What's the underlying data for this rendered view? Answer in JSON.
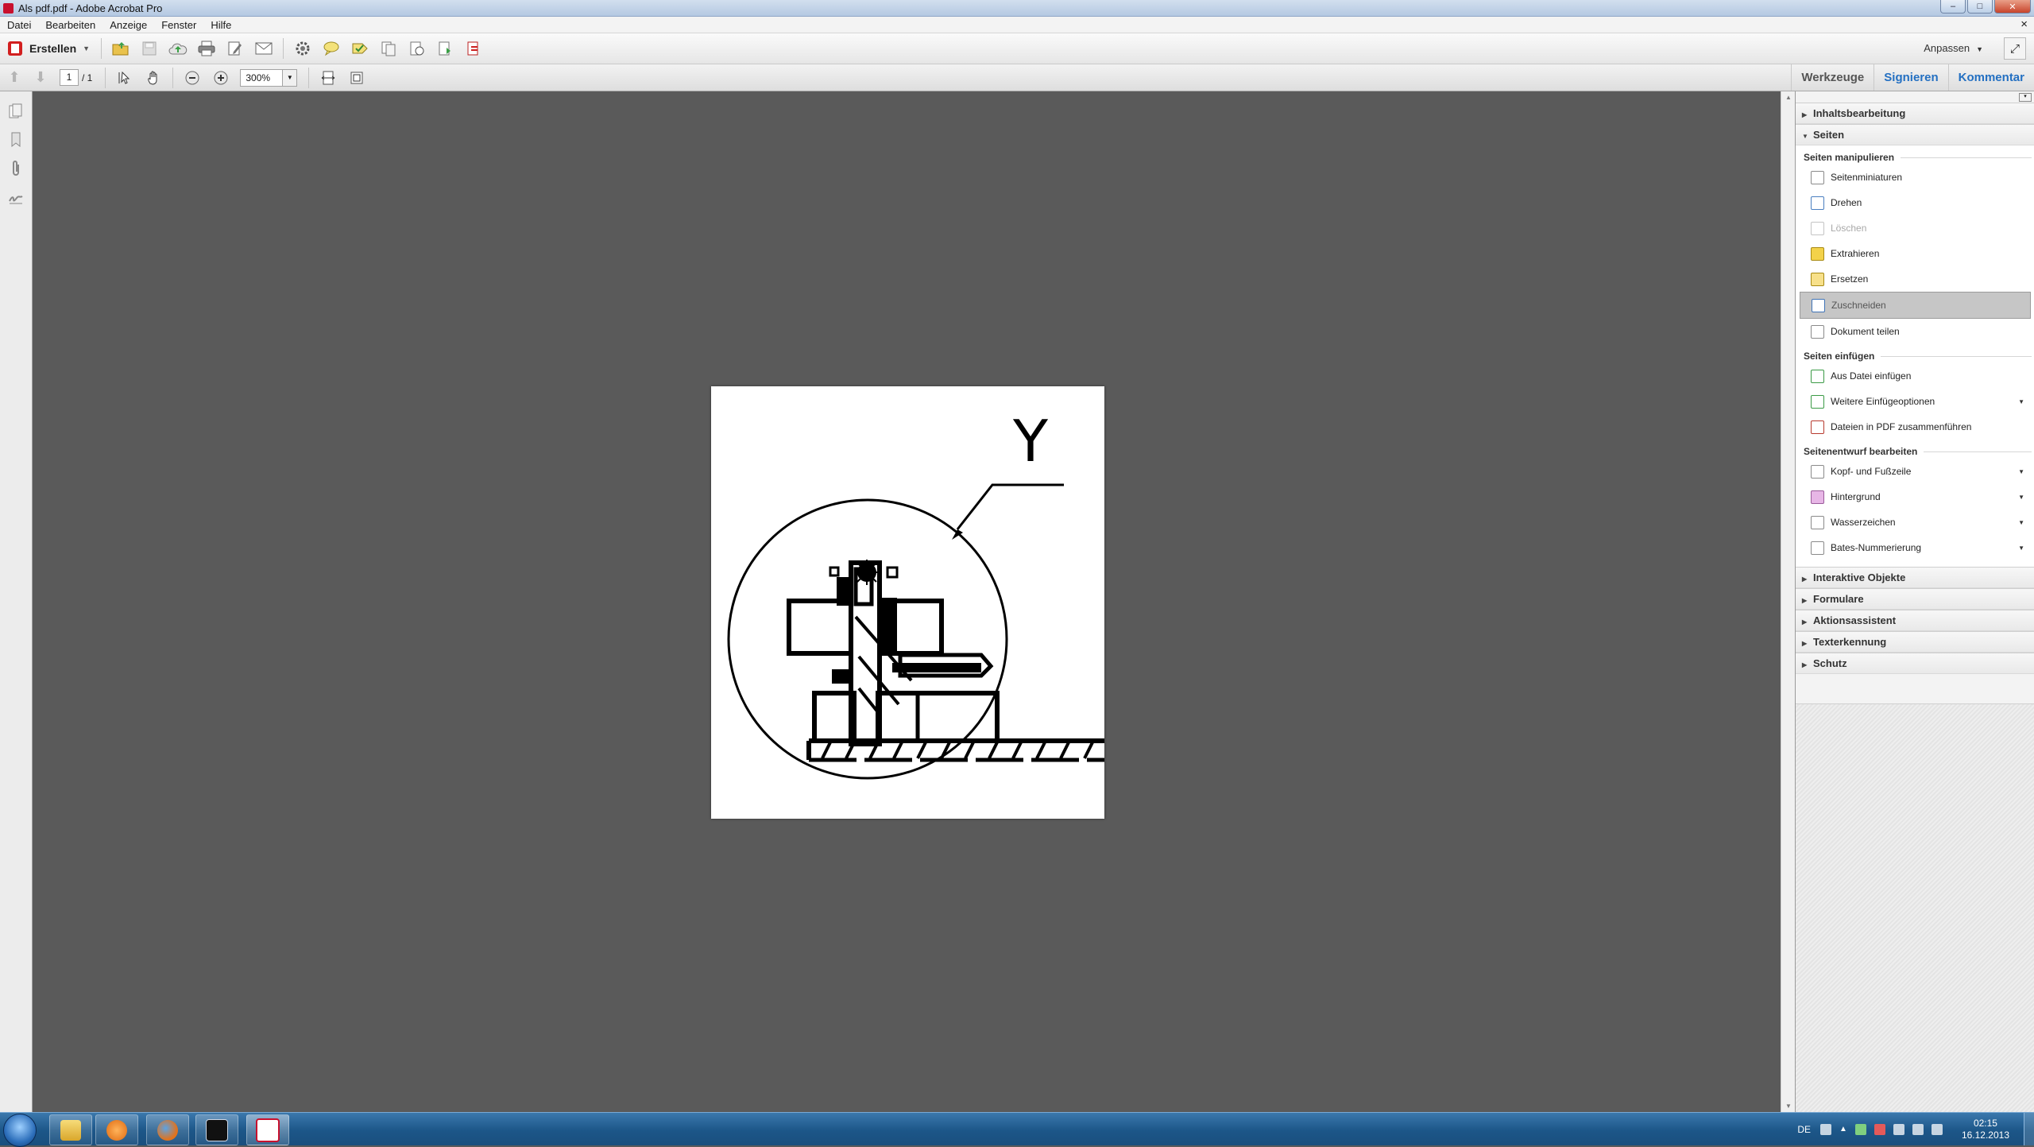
{
  "window": {
    "title": "Als pdf.pdf - Adobe Acrobat Pro",
    "controls": {
      "minimize": "–",
      "maximize": "□",
      "close": "✕"
    }
  },
  "menu": {
    "items": [
      "Datei",
      "Bearbeiten",
      "Anzeige",
      "Fenster",
      "Hilfe"
    ],
    "close_glyph": "×"
  },
  "toolbar": {
    "create_label": "Erstellen",
    "customize_label": "Anpassen",
    "icons": [
      "open-folder-icon",
      "save-icon",
      "cloud-upload-icon",
      "print-icon",
      "edit-icon",
      "email-icon",
      "gear-icon",
      "comment-icon",
      "stamp-icon",
      "pages-icon",
      "insert-pages-icon",
      "extract-icon",
      "combine-icon"
    ]
  },
  "navigation": {
    "current_page": "1",
    "page_total": "/ 1",
    "zoom": "300%"
  },
  "tabs": {
    "tools": "Werkzeuge",
    "sign": "Signieren",
    "comment": "Kommentar"
  },
  "document": {
    "drawing_label": "Y"
  },
  "tools_pane": {
    "content_editing": "Inhaltsbearbeitung",
    "pages": "Seiten",
    "manipulate_group": "Seiten manipulieren",
    "manipulate_items": [
      {
        "label": "Seitenminiaturen",
        "icon": "thumbnails-icon",
        "state": "normal"
      },
      {
        "label": "Drehen",
        "icon": "rotate-icon",
        "state": "normal"
      },
      {
        "label": "Löschen",
        "icon": "delete-icon",
        "state": "disabled"
      },
      {
        "label": "Extrahieren",
        "icon": "extract-icon",
        "state": "normal"
      },
      {
        "label": "Ersetzen",
        "icon": "replace-icon",
        "state": "normal"
      },
      {
        "label": "Zuschneiden",
        "icon": "crop-icon",
        "state": "selected"
      },
      {
        "label": "Dokument teilen",
        "icon": "split-icon",
        "state": "normal"
      }
    ],
    "insert_group": "Seiten einfügen",
    "insert_items": [
      {
        "label": "Aus Datei einfügen",
        "icon": "insert-file-icon",
        "dropdown": false
      },
      {
        "label": "Weitere Einfügeoptionen",
        "icon": "more-insert-icon",
        "dropdown": true
      },
      {
        "label": "Dateien in PDF zusammenführen",
        "icon": "combine-files-icon",
        "dropdown": false
      }
    ],
    "design_group": "Seitenentwurf bearbeiten",
    "design_items": [
      {
        "label": "Kopf- und Fußzeile",
        "icon": "header-footer-icon",
        "dropdown": true
      },
      {
        "label": "Hintergrund",
        "icon": "background-icon",
        "dropdown": true
      },
      {
        "label": "Wasserzeichen",
        "icon": "watermark-icon",
        "dropdown": true
      },
      {
        "label": "Bates-Nummerierung",
        "icon": "bates-icon",
        "dropdown": true
      }
    ],
    "collapsed_sections": [
      "Interaktive Objekte",
      "Formulare",
      "Aktionsassistent",
      "Texterkennung",
      "Schutz"
    ]
  },
  "taskbar": {
    "language": "DE",
    "time": "02:15",
    "date": "16.12.2013",
    "apps": [
      "explorer-icon",
      "media-player-icon",
      "firefox-icon",
      "terminal-icon",
      "acrobat-icon"
    ]
  },
  "colors": {
    "accent_tab": "#2470c2",
    "selected_tool_bg": "#c6c6c6",
    "doc_background": "#5a5a5a"
  }
}
